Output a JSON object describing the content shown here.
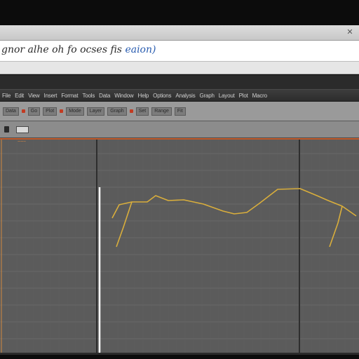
{
  "caption": {
    "text_start": "gnor alhe oh fo ocses fis",
    "text_accent": "eaion)"
  },
  "window": {
    "close_glyph": "✕"
  },
  "menu": {
    "items": [
      "File",
      "Edit",
      "View",
      "Insert",
      "Format",
      "Tools",
      "Data",
      "Window",
      "Help",
      "Options",
      "Analysis",
      "Graph",
      "Layout",
      "Plot",
      "Macro"
    ]
  },
  "toolbar": {
    "buttons": [
      "Data",
      "Go",
      "Plot",
      "Mode",
      "Layer",
      "Graph",
      "Set",
      "Range",
      "Fit"
    ]
  },
  "plot": {
    "marker_label": "~~~"
  },
  "chart_data": {
    "type": "line",
    "series": [
      {
        "values": [
          [
            160,
            311
          ],
          [
            170,
            292
          ],
          [
            188,
            288
          ],
          [
            210,
            288
          ],
          [
            222,
            279
          ],
          [
            240,
            286
          ],
          [
            262,
            285
          ],
          [
            290,
            291
          ],
          [
            318,
            301
          ],
          [
            334,
            305
          ],
          [
            352,
            303
          ],
          [
            370,
            290
          ],
          [
            396,
            270
          ],
          [
            428,
            269
          ],
          [
            452,
            279
          ],
          [
            468,
            286
          ],
          [
            488,
            294
          ],
          [
            508,
            308
          ]
        ]
      },
      {
        "values": [
          [
            166,
            352
          ],
          [
            176,
            324
          ],
          [
            188,
            288
          ]
        ]
      },
      {
        "values": [
          [
            470,
            352
          ],
          [
            482,
            318
          ],
          [
            488,
            294
          ]
        ]
      }
    ],
    "colors": {
      "line": "#d9ae3c",
      "cursor": "#ffffff",
      "grid": "#6a6a6a",
      "divider": "#2e2e2e",
      "background": "#5b5b5b",
      "top_marker": "#c05a2a"
    }
  }
}
